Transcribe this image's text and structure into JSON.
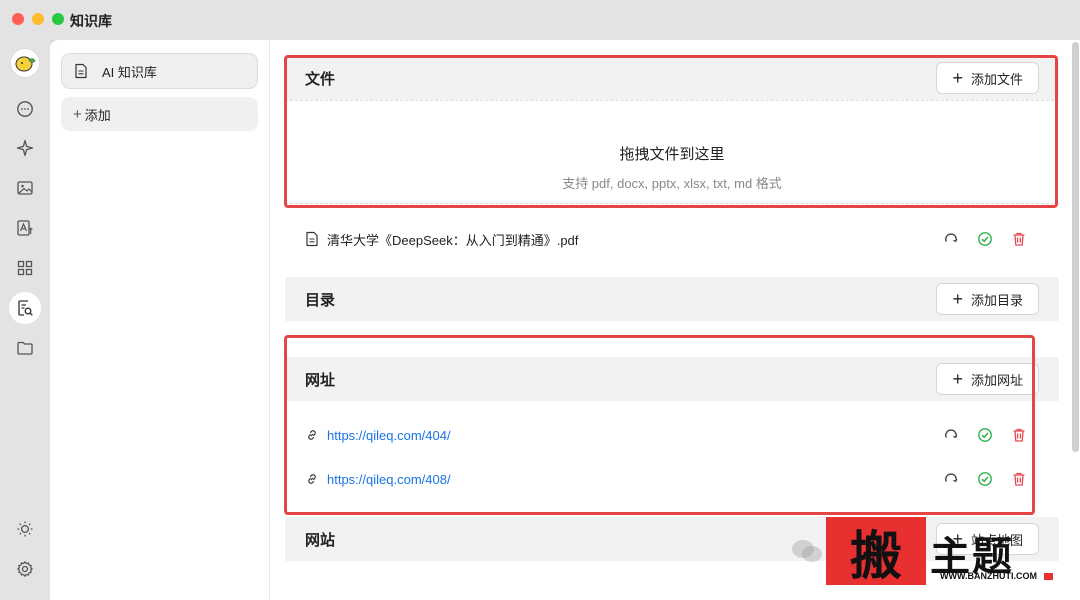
{
  "window": {
    "title": "知识库"
  },
  "sidebar": {
    "items": [
      {
        "label": "AI 知识库",
        "icon": "document-icon"
      }
    ],
    "add_label": "添加"
  },
  "rail": {
    "icons": [
      "avatar",
      "chat-icon",
      "sparkle-icon",
      "image-icon",
      "translate-icon",
      "apps-icon",
      "knowledge-icon",
      "folder-icon",
      "sun-icon",
      "gear-icon"
    ],
    "active": "knowledge-icon"
  },
  "files": {
    "title": "文件",
    "add_label": "添加文件",
    "drop_title": "拖拽文件到这里",
    "drop_hint": "支持 pdf, docx, pptx, xlsx, txt, md 格式",
    "items": [
      {
        "name": "清华大学《DeepSeek：从入门到精通》.pdf"
      }
    ]
  },
  "directories": {
    "title": "目录",
    "add_label": "添加目录"
  },
  "urls": {
    "title": "网址",
    "add_label": "添加网址",
    "items": [
      {
        "url": "https://qileq.com/404/"
      },
      {
        "url": "https://qileq.com/408/"
      }
    ]
  },
  "websites": {
    "title": "网站",
    "add_label": "站点地图"
  },
  "watermark": {
    "seal": "搬",
    "text": "主题",
    "url": "WWW.BANZHUTI.COM"
  },
  "colors": {
    "highlight": "#e64545",
    "link": "#1a73e8",
    "success": "#2bb24c",
    "danger": "#e5484d"
  }
}
